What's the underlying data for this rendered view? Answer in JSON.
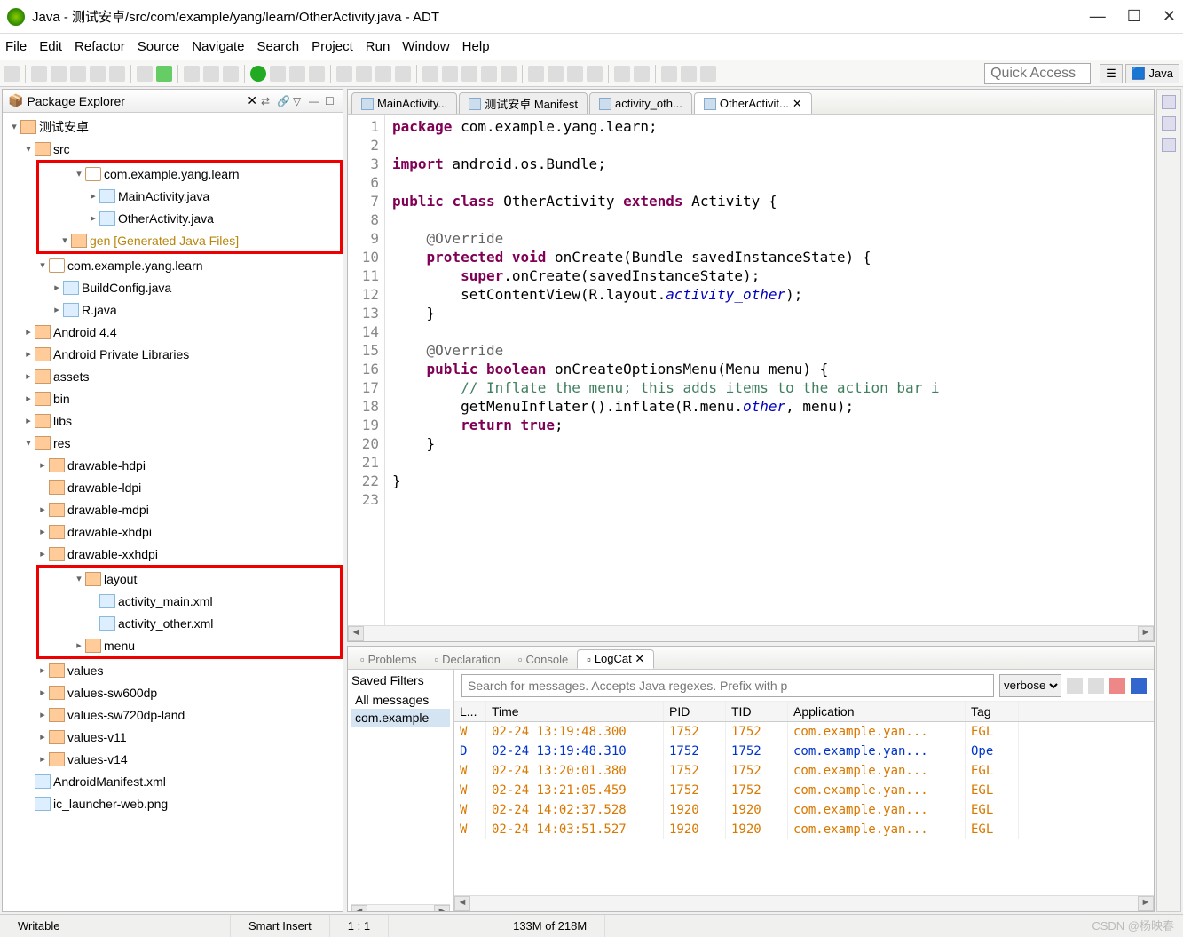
{
  "window": {
    "title": "Java - 测试安卓/src/com/example/yang/learn/OtherActivity.java - ADT"
  },
  "menu": [
    "File",
    "Edit",
    "Refactor",
    "Source",
    "Navigate",
    "Search",
    "Project",
    "Run",
    "Window",
    "Help"
  ],
  "quickaccess_placeholder": "Quick Access",
  "perspective_label": "Java",
  "explorer": {
    "title": "Package Explorer",
    "project": "测试安卓",
    "src": "src",
    "pkg": "com.example.yang.learn",
    "files": [
      "MainActivity.java",
      "OtherActivity.java"
    ],
    "gen": "gen [Generated Java Files]",
    "gen_pkg": "com.example.yang.learn",
    "gen_files": [
      "BuildConfig.java",
      "R.java"
    ],
    "libs_nodes": [
      "Android 4.4",
      "Android Private Libraries",
      "assets",
      "bin",
      "libs",
      "res"
    ],
    "res_children": [
      "drawable-hdpi",
      "drawable-ldpi",
      "drawable-mdpi",
      "drawable-xhdpi",
      "drawable-xxhdpi"
    ],
    "layout": "layout",
    "layout_files": [
      "activity_main.xml",
      "activity_other.xml"
    ],
    "menu_folder": "menu",
    "values": [
      "values",
      "values-sw600dp",
      "values-sw720dp-land",
      "values-v11",
      "values-v14"
    ],
    "root_files": [
      "AndroidManifest.xml",
      "ic_launcher-web.png"
    ]
  },
  "editor_tabs": [
    "MainActivity...",
    "测试安卓 Manifest",
    "activity_oth...",
    "OtherActivit..."
  ],
  "active_tab": 3,
  "code": {
    "lines": [
      {
        "n": 1,
        "html": "<span class='kw'>package</span> com.example.yang.learn;"
      },
      {
        "n": 2,
        "html": ""
      },
      {
        "n": 3,
        "html": "<span class='kw'>import</span> android.os.Bundle;",
        "marker": "⊕"
      },
      {
        "n": 6,
        "html": ""
      },
      {
        "n": 7,
        "html": "<span class='kw'>public</span> <span class='kw'>class</span> OtherActivity <span class='kw'>extends</span> Activity {"
      },
      {
        "n": 8,
        "html": ""
      },
      {
        "n": 9,
        "html": "    <span class='ann'>@Override</span>",
        "marker": "⊖"
      },
      {
        "n": 10,
        "html": "    <span class='kw'>protected</span> <span class='kw'>void</span> onCreate(Bundle savedInstanceState) {",
        "marker": "▲"
      },
      {
        "n": 11,
        "html": "        <span class='kw'>super</span>.onCreate(savedInstanceState);"
      },
      {
        "n": 12,
        "html": "        setContentView(R.layout.<span class='fld'>activity_other</span>);"
      },
      {
        "n": 13,
        "html": "    }"
      },
      {
        "n": 14,
        "html": ""
      },
      {
        "n": 15,
        "html": "    <span class='ann'>@Override</span>"
      },
      {
        "n": 16,
        "html": "    <span class='kw'>public</span> <span class='kw'>boolean</span> onCreateOptionsMenu(Menu menu) {",
        "marker": "▲"
      },
      {
        "n": 17,
        "html": "        <span class='cmt'>// Inflate the menu; this adds items to the action bar i</span>"
      },
      {
        "n": 18,
        "html": "        getMenuInflater().inflate(R.menu.<span class='fld'>other</span>, menu);"
      },
      {
        "n": 19,
        "html": "        <span class='kw'>return</span> <span class='kw'>true</span>;"
      },
      {
        "n": 20,
        "html": "    }"
      },
      {
        "n": 21,
        "html": ""
      },
      {
        "n": 22,
        "html": "}"
      },
      {
        "n": 23,
        "html": ""
      }
    ]
  },
  "bottom_tabs": [
    "Problems",
    "Declaration",
    "Console",
    "LogCat"
  ],
  "filters": {
    "title": "Saved Filters",
    "rows": [
      "All messages",
      "com.example"
    ]
  },
  "logcat": {
    "search_placeholder": "Search for messages. Accepts Java regexes. Prefix with p",
    "level": "verbose",
    "columns": [
      "L...",
      "Time",
      "PID",
      "TID",
      "Application",
      "Tag"
    ],
    "rows": [
      {
        "lvl": "W",
        "time": "02-24 13:19:48.300",
        "pid": "1752",
        "tid": "1752",
        "app": "com.example.yan...",
        "tag": "EGL"
      },
      {
        "lvl": "D",
        "time": "02-24 13:19:48.310",
        "pid": "1752",
        "tid": "1752",
        "app": "com.example.yan...",
        "tag": "Ope"
      },
      {
        "lvl": "W",
        "time": "02-24 13:20:01.380",
        "pid": "1752",
        "tid": "1752",
        "app": "com.example.yan...",
        "tag": "EGL"
      },
      {
        "lvl": "W",
        "time": "02-24 13:21:05.459",
        "pid": "1752",
        "tid": "1752",
        "app": "com.example.yan...",
        "tag": "EGL"
      },
      {
        "lvl": "W",
        "time": "02-24 14:02:37.528",
        "pid": "1920",
        "tid": "1920",
        "app": "com.example.yan...",
        "tag": "EGL"
      },
      {
        "lvl": "W",
        "time": "02-24 14:03:51.527",
        "pid": "1920",
        "tid": "1920",
        "app": "com.example.yan...",
        "tag": "EGL"
      }
    ]
  },
  "status": {
    "writable": "Writable",
    "insert": "Smart Insert",
    "pos": "1 : 1",
    "mem": "133M of 218M"
  },
  "watermark": "CSDN @杨映春"
}
